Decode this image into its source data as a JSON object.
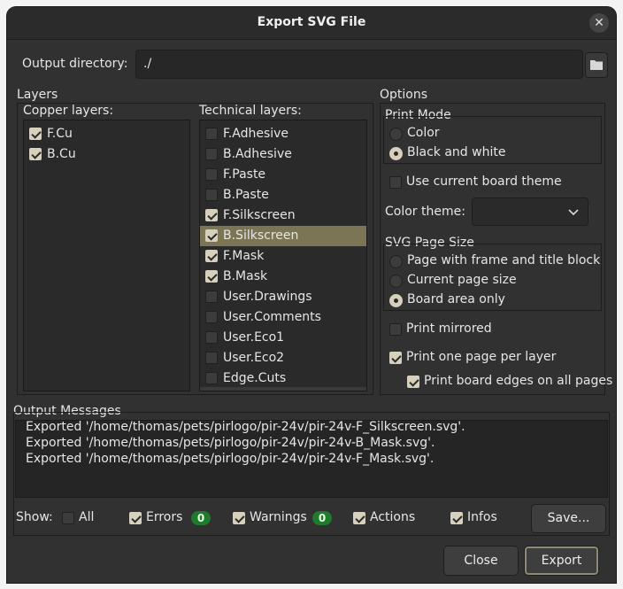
{
  "window": {
    "title": "Export SVG File",
    "close_glyph": "✕"
  },
  "output_dir": {
    "label": "Output directory:",
    "value": "./",
    "browse_icon": "folder-icon"
  },
  "layers": {
    "group_label": "Layers",
    "copper_label": "Copper layers:",
    "copper": [
      {
        "name": "F.Cu",
        "checked": true
      },
      {
        "name": "B.Cu",
        "checked": true
      }
    ],
    "technical_label": "Technical layers:",
    "technical": [
      {
        "name": "F.Adhesive",
        "checked": false
      },
      {
        "name": "B.Adhesive",
        "checked": false
      },
      {
        "name": "F.Paste",
        "checked": false
      },
      {
        "name": "B.Paste",
        "checked": false
      },
      {
        "name": "F.Silkscreen",
        "checked": true
      },
      {
        "name": "B.Silkscreen",
        "checked": true,
        "selected": true
      },
      {
        "name": "F.Mask",
        "checked": true
      },
      {
        "name": "B.Mask",
        "checked": true
      },
      {
        "name": "User.Drawings",
        "checked": false
      },
      {
        "name": "User.Comments",
        "checked": false
      },
      {
        "name": "User.Eco1",
        "checked": false
      },
      {
        "name": "User.Eco2",
        "checked": false
      },
      {
        "name": "Edge.Cuts",
        "checked": false
      }
    ]
  },
  "options": {
    "group_label": "Options",
    "print_mode": {
      "label": "Print Mode",
      "color": "Color",
      "bw": "Black and white",
      "selected": "bw"
    },
    "use_board_theme": {
      "label": "Use current board theme",
      "checked": false
    },
    "color_theme": {
      "label": "Color theme:",
      "value": ""
    },
    "page_size": {
      "label": "SVG Page Size",
      "frame": "Page with frame and title block",
      "current": "Current page size",
      "board": "Board area only",
      "selected": "board"
    },
    "print_mirrored": {
      "label": "Print mirrored",
      "checked": false
    },
    "one_page_per_layer": {
      "label": "Print one page per layer",
      "checked": true
    },
    "board_edges_all": {
      "label": "Print board edges on all pages",
      "checked": true
    }
  },
  "messages": {
    "label": "Output Messages",
    "lines": [
      "Exported '/home/thomas/pets/pirlogo/pir-24v/pir-24v-F_Silkscreen.svg'.",
      "Exported '/home/thomas/pets/pirlogo/pir-24v/pir-24v-B_Mask.svg'.",
      "Exported '/home/thomas/pets/pirlogo/pir-24v/pir-24v-F_Mask.svg'."
    ],
    "show_label": "Show:",
    "filters": {
      "all": {
        "label": "All",
        "checked": false
      },
      "errors": {
        "label": "Errors",
        "checked": true,
        "count": "0"
      },
      "warnings": {
        "label": "Warnings",
        "checked": true,
        "count": "0"
      },
      "actions": {
        "label": "Actions",
        "checked": true
      },
      "infos": {
        "label": "Infos",
        "checked": true
      }
    },
    "save_label": "Save..."
  },
  "buttons": {
    "close": "Close",
    "export": "Export"
  },
  "colors": {
    "selection": "#7b7555",
    "badge": "#1f7a2b",
    "checked": "#d6d0bd"
  }
}
